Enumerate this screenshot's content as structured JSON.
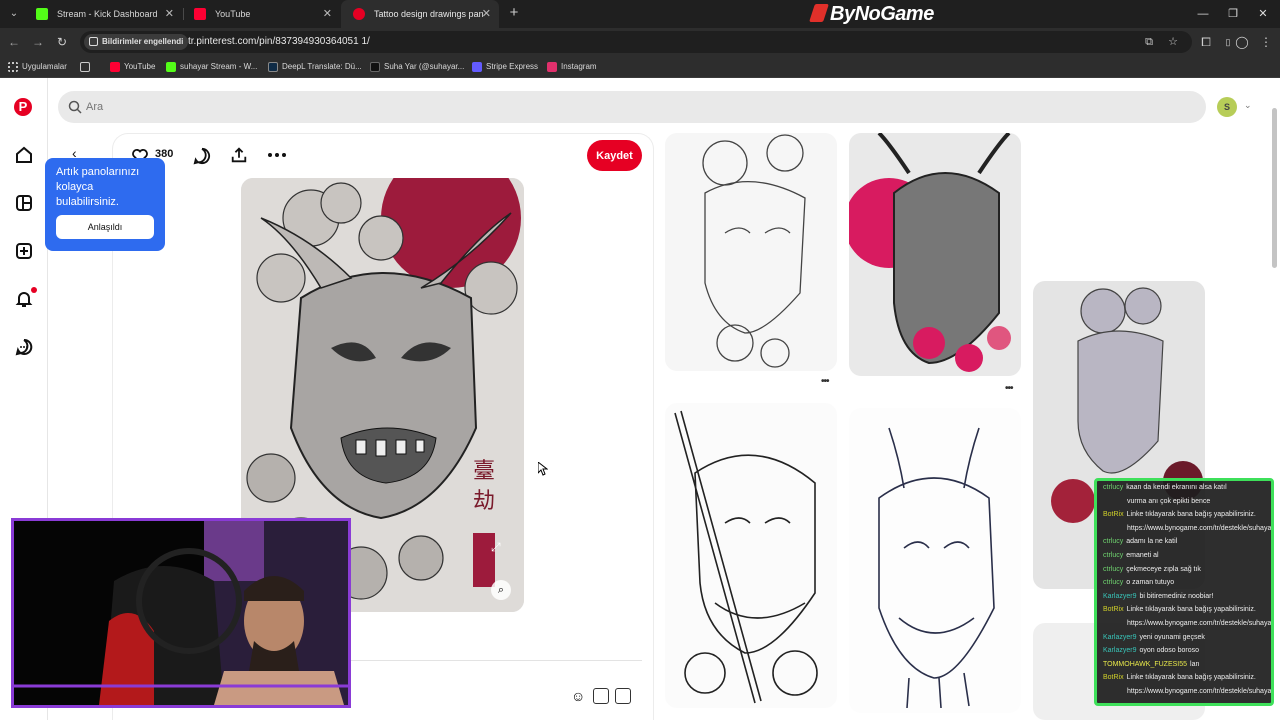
{
  "browser": {
    "tabs": [
      {
        "title": "Stream - Kick Dashboard",
        "favicon_color": "#53fc18"
      },
      {
        "title": "YouTube",
        "favicon_color": "#ff0033"
      },
      {
        "title": "Tattoo design drawings panosu",
        "favicon_color": "#e60023"
      }
    ],
    "brand_overlay": "ByNoGame",
    "notification_chip": "Bildirimler engellendi",
    "url": "tr.pinterest.com/pin/837394930364051 1/",
    "bookmarks": [
      {
        "label": "Uygulamalar",
        "icon": "apps-grid-icon",
        "color": "#c9c9c9"
      },
      {
        "label": "YouTube",
        "icon": "youtube-icon",
        "color": "#ff0033"
      },
      {
        "label": "suhayar Stream - W...",
        "icon": "kick-icon",
        "color": "#53fc18"
      },
      {
        "label": "DeepL Translate: Dü...",
        "icon": "deepl-icon",
        "color": "#0f2b46"
      },
      {
        "label": "Suha Yar (@suhayar...",
        "icon": "tiktok-icon",
        "color": "#111111"
      },
      {
        "label": "Stripe Express",
        "icon": "stripe-icon",
        "color": "#635bff"
      },
      {
        "label": "Instagram",
        "icon": "instagram-icon",
        "color": "#e1306c"
      }
    ]
  },
  "pinterest": {
    "accent": "#e60023",
    "search": {
      "placeholder": "Ara"
    },
    "account_initial": "S",
    "pin": {
      "like_count": "380",
      "save_label": "Kaydet",
      "image_caption_kanji": "臺 劫"
    },
    "tooltip": {
      "text": "Artık panolarınızı kolayca bulabilirsiniz.",
      "button": "Anlaşıldı"
    }
  },
  "chat": {
    "messages": [
      {
        "user": "ctrlucy",
        "text": "kaan da kendi ekranını alsa katıl",
        "color": "#6fd36f"
      },
      {
        "user": "",
        "text": "vurma anı çok epikti bence",
        "color": "#6fd36f"
      },
      {
        "user": "BotRix",
        "text": "Linke tıklayarak bana bağış yapabilirsiniz.",
        "color": "#d1d12a"
      },
      {
        "user": "",
        "text": "https://www.bynogame.com/tr/destekle/suhayar",
        "color": "#d1d12a"
      },
      {
        "user": "ctrlucy",
        "text": "adamı la ne katil",
        "color": "#6fd36f"
      },
      {
        "user": "ctrlucy",
        "text": "emaneti al",
        "color": "#6fd36f"
      },
      {
        "user": "ctrlucy",
        "text": "çekmeceye zıpla sağ tık",
        "color": "#6fd36f"
      },
      {
        "user": "ctrlucy",
        "text": "o zaman tutuyo",
        "color": "#6fd36f"
      },
      {
        "user": "Karlazyer9",
        "text": "bi bitiremediniz noobiar!",
        "color": "#38c4b8"
      },
      {
        "user": "BotRix",
        "text": "Linke tıklayarak bana bağış yapabilirsiniz.",
        "color": "#d1d12a"
      },
      {
        "user": "",
        "text": "https://www.bynogame.com/tr/destekle/suhayar",
        "color": "#d1d12a"
      },
      {
        "user": "Karlazyer9",
        "text": "yeni oyunami geçsek",
        "color": "#38c4b8"
      },
      {
        "user": "Karlazyer9",
        "text": "oyon odoso boroso",
        "color": "#38c4b8"
      },
      {
        "user": "TOMMOHAWK_FUZESI55",
        "text": "lan",
        "color": "#e8e84a"
      },
      {
        "user": "BotRix",
        "text": "Linke tıklayarak bana bağış yapabilirsiniz.",
        "color": "#d1d12a"
      },
      {
        "user": "",
        "text": "https://www.bynogame.com/tr/destekle/suhayar",
        "color": "#d1d12a"
      }
    ]
  }
}
